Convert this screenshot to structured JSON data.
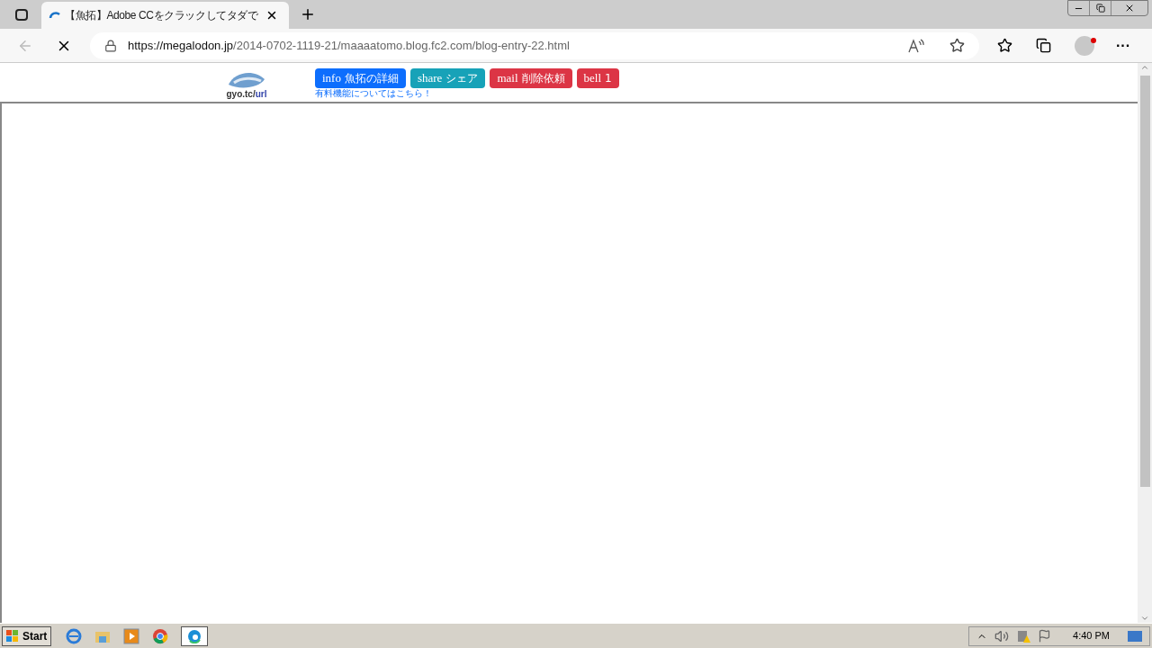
{
  "tab": {
    "title": "【魚拓】Adobe CCをクラックしてタダで",
    "loading": true
  },
  "address": {
    "host": "https://megalodon.jp",
    "path": "/2014-0702-1119-21/maaaatomo.blog.fc2.com/blog-entry-22.html"
  },
  "toolbar": {
    "more": "···"
  },
  "header": {
    "logo_text": "gyo.tc/",
    "logo_link": "url",
    "note": "有料機能についてはこちら！",
    "buttons": [
      {
        "icon": "info",
        "label": "魚拓の詳細",
        "color": "#0d6efd"
      },
      {
        "icon": "share",
        "label": "シェア",
        "color": "#17a2b8"
      },
      {
        "icon": "mail",
        "label": "削除依頼",
        "color": "#dc3545"
      },
      {
        "icon": "bell",
        "label": "1",
        "color": "#dc3545"
      }
    ]
  },
  "taskbar": {
    "start": "Start",
    "clock": "4:40 PM"
  }
}
